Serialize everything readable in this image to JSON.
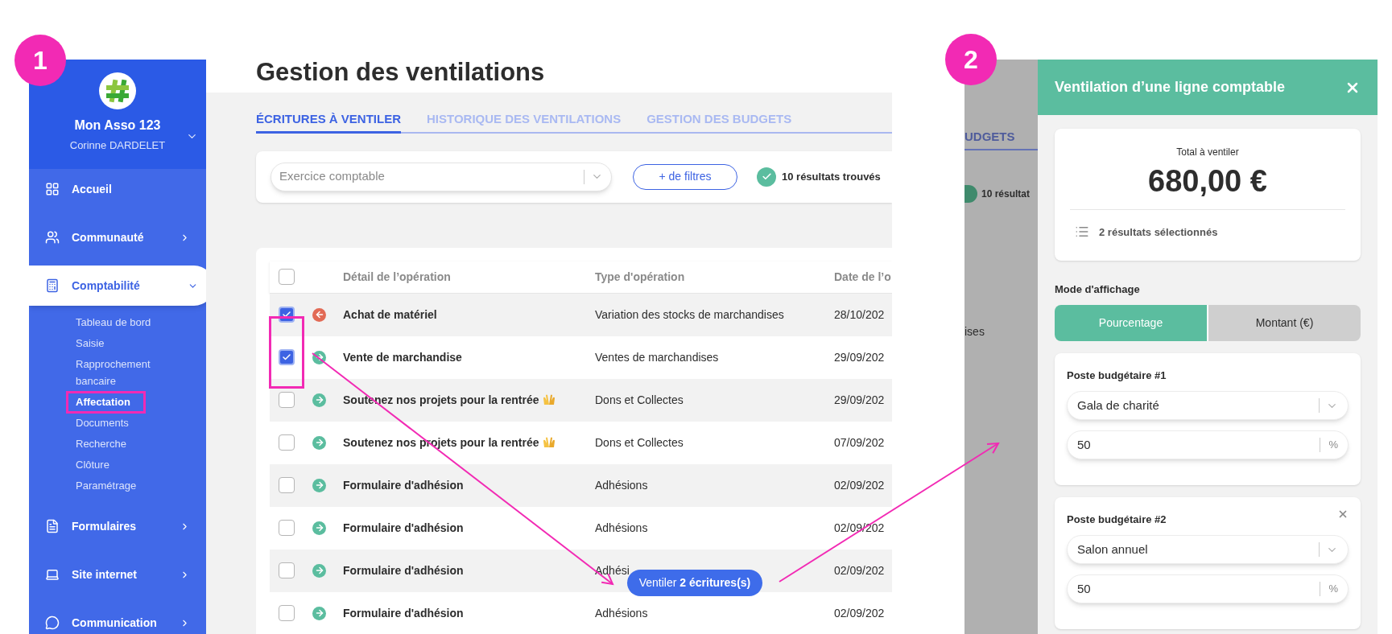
{
  "annotations": {
    "badges": [
      {
        "label": "1"
      },
      {
        "label": "2"
      }
    ]
  },
  "sidebar": {
    "org_name": "Mon Asso 123",
    "user_name": "Corinne DARDELET",
    "items": [
      {
        "label": "Accueil",
        "kind": "link",
        "selected": false
      },
      {
        "label": "Communauté",
        "kind": "group",
        "selected": false,
        "expanded": false
      },
      {
        "label": "Comptabilité",
        "kind": "group",
        "selected": true,
        "expanded": true,
        "children": [
          {
            "label": "Tableau de bord",
            "selected": false
          },
          {
            "label": "Saisie",
            "selected": false
          },
          {
            "label": "Rapprochement bancaire",
            "selected": false
          },
          {
            "label": "Affectation",
            "selected": true
          },
          {
            "label": "Documents",
            "selected": false
          },
          {
            "label": "Recherche",
            "selected": false
          },
          {
            "label": "Clôture",
            "selected": false
          },
          {
            "label": "Paramétrage",
            "selected": false
          }
        ]
      },
      {
        "label": "Formulaires",
        "kind": "group",
        "selected": false,
        "expanded": false
      },
      {
        "label": "Site internet",
        "kind": "group",
        "selected": false,
        "expanded": false
      },
      {
        "label": "Communication",
        "kind": "group",
        "selected": false,
        "expanded": false
      }
    ]
  },
  "page": {
    "title": "Gestion des ventilations",
    "tabs": [
      {
        "label": "ÉCRITURES À VENTILER",
        "selected": true
      },
      {
        "label": "HISTORIQUE DES VENTILATIONS",
        "selected": false
      },
      {
        "label": "GESTION DES BUDGETS",
        "selected": false
      }
    ],
    "filter": {
      "placeholder": "Exercice comptable",
      "button": "+ de filtres",
      "results": "10 résultats trouvés"
    },
    "table": {
      "all_selected": false,
      "columns": [
        "Détail de l’opération",
        "Type d'opération",
        "Date de l’o"
      ],
      "rows": [
        {
          "detail": "Achat de matériel",
          "type": "Variation des stocks de marchandises",
          "date": "28/10/202",
          "outgoing": true,
          "emoji": false,
          "selected": true
        },
        {
          "detail": "Vente de marchandise",
          "type": "Ventes de marchandises",
          "date": "29/09/202",
          "outgoing": false,
          "emoji": false,
          "selected": true
        },
        {
          "detail": "Soutenez nos projets pour la rentrée",
          "type": "Dons et Collectes",
          "date": "29/09/202",
          "outgoing": false,
          "emoji": true,
          "selected": false
        },
        {
          "detail": "Soutenez nos projets pour la rentrée",
          "type": "Dons et Collectes",
          "date": "07/09/202",
          "outgoing": false,
          "emoji": true,
          "selected": false
        },
        {
          "detail": "Formulaire d'adhésion",
          "type": "Adhésions",
          "date": "02/09/202",
          "outgoing": false,
          "emoji": false,
          "selected": false
        },
        {
          "detail": "Formulaire d'adhésion",
          "type": "Adhésions",
          "date": "02/09/202",
          "outgoing": false,
          "emoji": false,
          "selected": false
        },
        {
          "detail": "Formulaire d'adhésion",
          "type": "Adhési",
          "date": "02/09/202",
          "outgoing": false,
          "emoji": false,
          "selected": false
        },
        {
          "detail": "Formulaire d'adhésion",
          "type": "Adhésions",
          "date": "02/09/202",
          "outgoing": false,
          "emoji": false,
          "selected": false
        }
      ]
    },
    "action_button": "Ventiler **2 écritures(s)**"
  },
  "right_screen": {
    "background": {
      "tab": "UDGETS",
      "results": "10 résultat",
      "cell": "ises"
    },
    "panel": {
      "title": "Ventilation d’une ligne comptable",
      "total_label": "Total à ventiler",
      "total": "680,00 €",
      "selection": "2 résultats sélectionnés",
      "mode_label": "Mode d'affichage",
      "modes": [
        {
          "label": "Pourcentage",
          "selected": true
        },
        {
          "label": "Montant (€)",
          "selected": false
        }
      ],
      "postes": [
        {
          "title": "Poste budgétaire #1",
          "budget": "Gala de charité",
          "amount": "50",
          "unit": "%",
          "removable": false
        },
        {
          "title": "Poste budgétaire #2",
          "budget": "Salon annuel",
          "amount": "50",
          "unit": "%",
          "removable": true
        }
      ]
    }
  }
}
